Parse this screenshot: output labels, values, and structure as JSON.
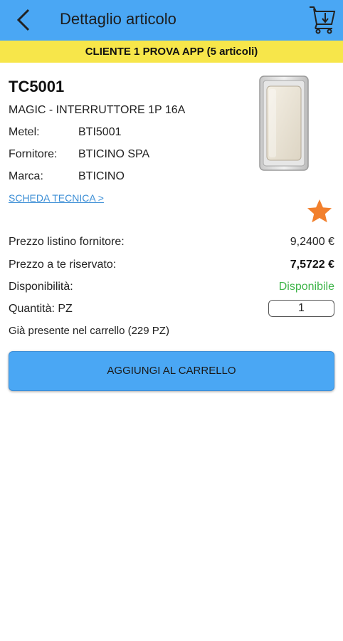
{
  "header": {
    "title": "Dettaglio articolo",
    "back_icon": "chevron-left-icon",
    "cart_icon": "shopping-cart-icon",
    "bar_color": "#4aa7f4"
  },
  "customer_banner": {
    "text": "CLIENTE 1 PROVA APP (5 articoli)",
    "color": "#f7e64a"
  },
  "product": {
    "code": "TC5001",
    "description": "MAGIC - INTERRUTTORE 1P 16A",
    "details": [
      {
        "label": "Metel:",
        "value": "BTI5001"
      },
      {
        "label": "Fornitore:",
        "value": "BTICINO SPA"
      },
      {
        "label": "Marca:",
        "value": "BTICINO"
      }
    ],
    "datasheet_link": "SCHEDA TECNICA >",
    "favorite_icon": "star-icon"
  },
  "pricing": {
    "list_price_label": "Prezzo listino fornitore:",
    "list_price_value": "9,2400 €",
    "reserved_price_label": "Prezzo a te riservato:",
    "reserved_price_value": "7,5722 €",
    "availability_label": "Disponibilità:",
    "availability_value": "Disponibile",
    "availability_color": "#3fb54a",
    "quantity_label": "Quantità: PZ",
    "quantity_value": "1",
    "in_cart_text": "Già presente nel carrello (229 PZ)"
  },
  "actions": {
    "add_to_cart_label": "AGGIUNGI AL CARRELLO"
  }
}
